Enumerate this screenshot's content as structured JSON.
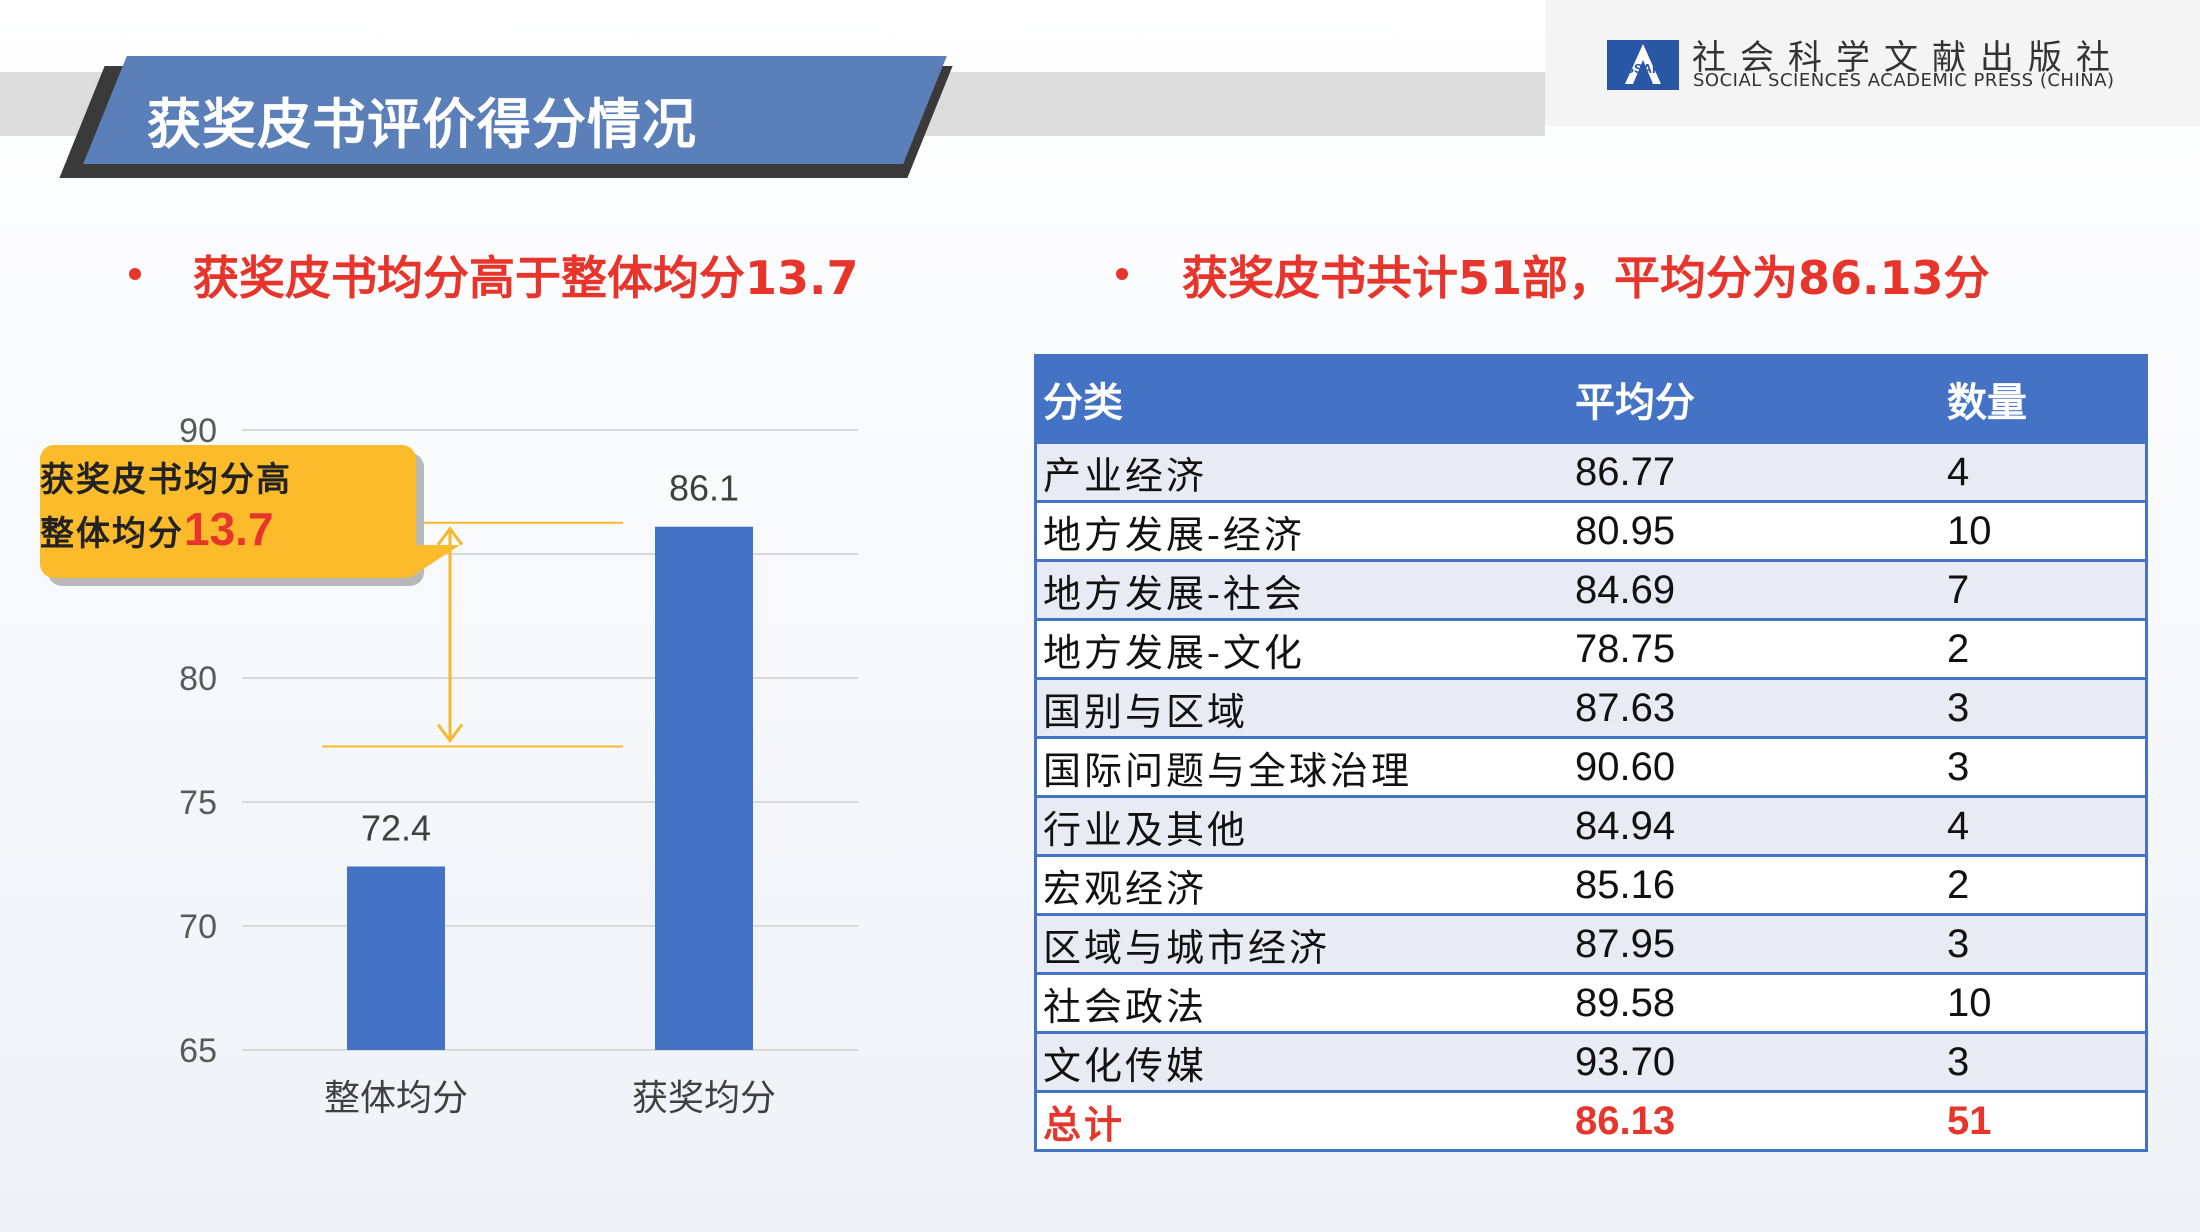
{
  "header": {
    "title": "获奖皮书评价得分情况",
    "logo_cn": "社会科学文献出版社",
    "logo_en": "SOCIAL SCIENCES ACADEMIC PRESS (CHINA)",
    "logo_mark": "SSAP"
  },
  "bullets": {
    "left": "获奖皮书均分高于整体均分13.7",
    "right": "获奖皮书共计51部，平均分为86.13分"
  },
  "callout": {
    "line1": "获奖皮书均分高",
    "line2": "整体均分",
    "value": "13.7"
  },
  "chart_data": {
    "type": "bar",
    "categories": [
      "整体均分",
      "获奖均分"
    ],
    "values": [
      72.4,
      86.1
    ],
    "value_labels": [
      "72.4",
      "86.1"
    ],
    "ylim": [
      65,
      90
    ],
    "yticks": [
      65,
      70,
      75,
      80,
      90
    ],
    "grid": true,
    "colors": {
      "bar": "#4472c4",
      "arrow": "#f5b82e",
      "grid": "#d9d9d9"
    }
  },
  "table": {
    "headers": [
      "分类",
      "平均分",
      "数量"
    ],
    "rows": [
      [
        "产业经济",
        "86.77",
        "4"
      ],
      [
        "地方发展-经济",
        "80.95",
        "10"
      ],
      [
        "地方发展-社会",
        "84.69",
        "7"
      ],
      [
        "地方发展-文化",
        "78.75",
        "2"
      ],
      [
        "国别与区域",
        "87.63",
        "3"
      ],
      [
        "国际问题与全球治理",
        "90.60",
        "3"
      ],
      [
        "行业及其他",
        "84.94",
        "4"
      ],
      [
        "宏观经济",
        "85.16",
        "2"
      ],
      [
        "区域与城市经济",
        "87.95",
        "3"
      ],
      [
        "社会政法",
        "89.58",
        "10"
      ],
      [
        "文化传媒",
        "93.70",
        "3"
      ]
    ],
    "total": [
      "总计",
      "86.13",
      "51"
    ]
  }
}
